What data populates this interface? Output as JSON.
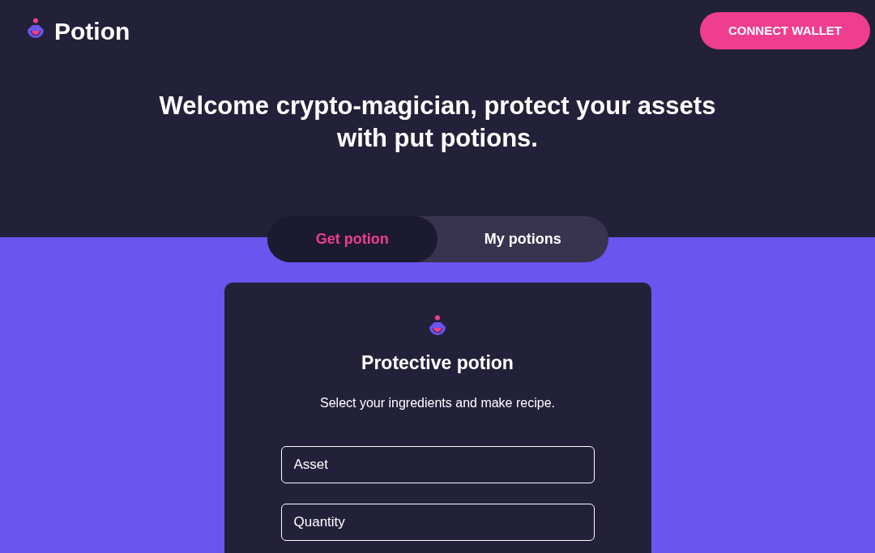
{
  "header": {
    "logo_text": "Potion",
    "connect_button": "CONNECT WALLET"
  },
  "hero": {
    "title": "Welcome crypto-magician, protect your assets with put potions."
  },
  "tabs": [
    {
      "label": "Get potion",
      "selected": true
    },
    {
      "label": "My potions",
      "selected": false
    }
  ],
  "card": {
    "title": "Protective potion",
    "subtitle": "Select your ingredients and make recipe.",
    "fields": [
      {
        "placeholder": "Asset"
      },
      {
        "placeholder": "Quantity"
      }
    ]
  }
}
